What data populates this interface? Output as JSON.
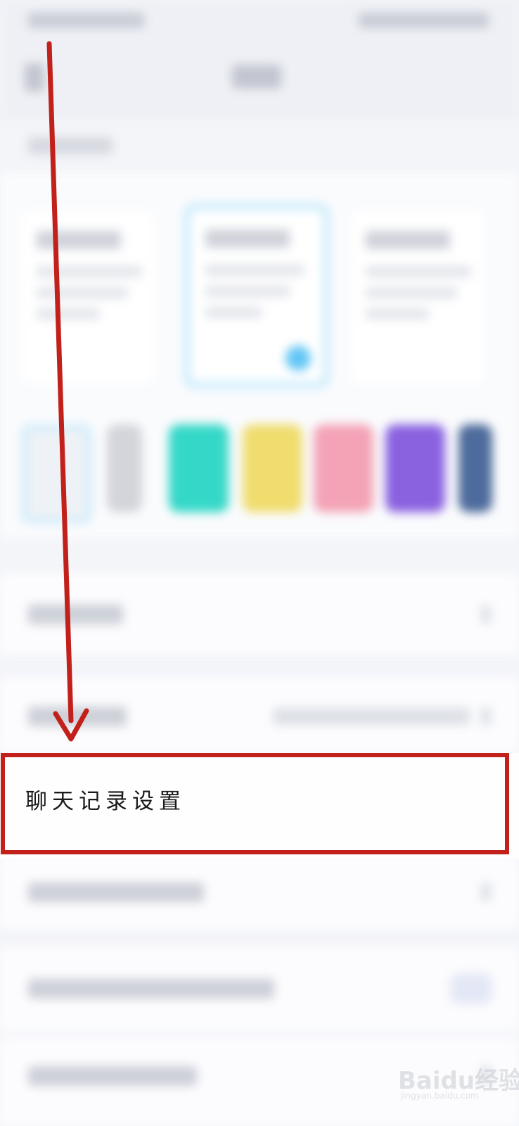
{
  "screen": {
    "background": "#f4f5f9"
  },
  "chat_history_row": {
    "label": "聊天记录设置"
  },
  "annotation": {
    "color": "#c2201a",
    "arrow_icon": "down-arrow-icon"
  },
  "theme_swatches": [
    {
      "name": "white",
      "color": "#eef2f6"
    },
    {
      "name": "dark",
      "color": "#5a5a60"
    },
    {
      "name": "teal",
      "color": "#35d8c8"
    },
    {
      "name": "yellow",
      "color": "#f0dd6e"
    },
    {
      "name": "pink",
      "color": "#f4a3b6"
    },
    {
      "name": "purple",
      "color": "#8a62e0"
    },
    {
      "name": "navy",
      "color": "#4d6b9c"
    }
  ],
  "watermark": {
    "brand": "Baidu经验",
    "site": "jingyan.baidu.com"
  }
}
